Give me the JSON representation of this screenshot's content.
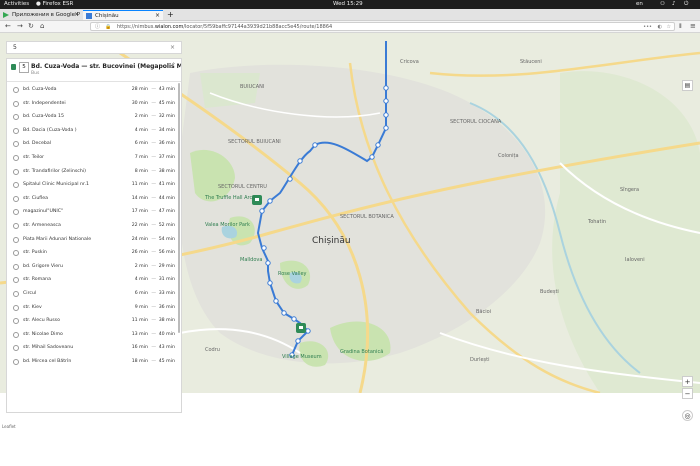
{
  "system": {
    "activities": "Activities",
    "app": "Firefox ESR",
    "clock": "Wed 15:29",
    "lang": "en"
  },
  "tabs": [
    {
      "label": "Приложения в Google P",
      "close": "×"
    },
    {
      "label": "Chișinău",
      "close": "×"
    }
  ],
  "new_tab": "+",
  "url": {
    "prefix": "https://nimbus.",
    "domain": "wialon.com",
    "path": "/locator/5f59baffc97144a3939d21b88acc5e45/route/18864"
  },
  "search": {
    "value": "5",
    "clear": "×"
  },
  "route": {
    "number": "5",
    "name": "Bd. Cuza-Voda — str. Bucovinei (Megapolis Mall)",
    "type": "Bus"
  },
  "stops": [
    {
      "name": "bd. Cuza-Voda",
      "t1": "28 min",
      "t2": "43 min"
    },
    {
      "name": "str. Independentei",
      "t1": "30 min",
      "t2": "45 min"
    },
    {
      "name": "bd. Cuza-Voda 15",
      "t1": "2 min",
      "t2": "32 min"
    },
    {
      "name": "Bd. Dacia (Cuza-Voda )",
      "t1": "4 min",
      "t2": "34 min"
    },
    {
      "name": "bd. Decebal",
      "t1": "6 min",
      "t2": "36 min"
    },
    {
      "name": "str. Teilor",
      "t1": "7 min",
      "t2": "37 min"
    },
    {
      "name": "str. Trandafirilor (Zelinschi)",
      "t1": "8 min",
      "t2": "38 min"
    },
    {
      "name": "Spitalul Clinic Municipal nr.1",
      "t1": "11 min",
      "t2": "41 min"
    },
    {
      "name": "str. Ciuflea",
      "t1": "14 min",
      "t2": "44 min"
    },
    {
      "name": "magazinul\"UNIC\"",
      "t1": "17 min",
      "t2": "47 min"
    },
    {
      "name": "str. Armeneasca",
      "t1": "22 min",
      "t2": "52 min"
    },
    {
      "name": "Piata Marii Adunari Nationale",
      "t1": "24 min",
      "t2": "54 min"
    },
    {
      "name": "str. Puskin",
      "t1": "26 min",
      "t2": "56 min"
    },
    {
      "name": "bd. Grigore Vieru",
      "t1": "2 min",
      "t2": "29 min"
    },
    {
      "name": "str. Romana",
      "t1": "4 min",
      "t2": "31 min"
    },
    {
      "name": "Circul",
      "t1": "6 min",
      "t2": "33 min"
    },
    {
      "name": "str. Kiev",
      "t1": "9 min",
      "t2": "36 min"
    },
    {
      "name": "str. Alecu Russo",
      "t1": "11 min",
      "t2": "38 min"
    },
    {
      "name": "str. Nicolae Dimo",
      "t1": "13 min",
      "t2": "40 min"
    },
    {
      "name": "str. Mihail Sadoveanu",
      "t1": "16 min",
      "t2": "43 min"
    },
    {
      "name": "bd. Mircea cel Bătrîn",
      "t1": "18 min",
      "t2": "45 min"
    }
  ],
  "dash": "—",
  "map_labels": {
    "city": "Chișinău",
    "truffle": "The Truffle Hall Arch",
    "valea": "Valea Morilor Park",
    "malldova": "Malldova",
    "rose": "Rose Valley",
    "village": "Village Museum",
    "botanic": "Gradina Botanică",
    "buiucani": "BUIUCANI",
    "sector_centru": "SECTORUL CENTRU",
    "sector_botanica": "SECTORUL BOTANICA",
    "sector_ciocana": "SECTORUL CIOCANA",
    "sector_buiucani": "SECTORUL BUIUCANI",
    "codru": "Codru",
    "colonita": "Colonița",
    "tohatin": "Tohatin",
    "budesti": "Budești",
    "bacioi": "Băcioi",
    "ialoveni": "Ialoveni",
    "singera": "Sîngera",
    "durlesti": "Durlești",
    "stauceni": "Stăuceni",
    "cricova": "Cricova"
  },
  "controls": {
    "zoom_in": "+",
    "zoom_out": "−",
    "locate": "◎"
  },
  "attribution": "Leaflet",
  "colors": {
    "route": "#3a7bd5",
    "bus": "#2e8b57",
    "park": "#c9e3b0"
  }
}
